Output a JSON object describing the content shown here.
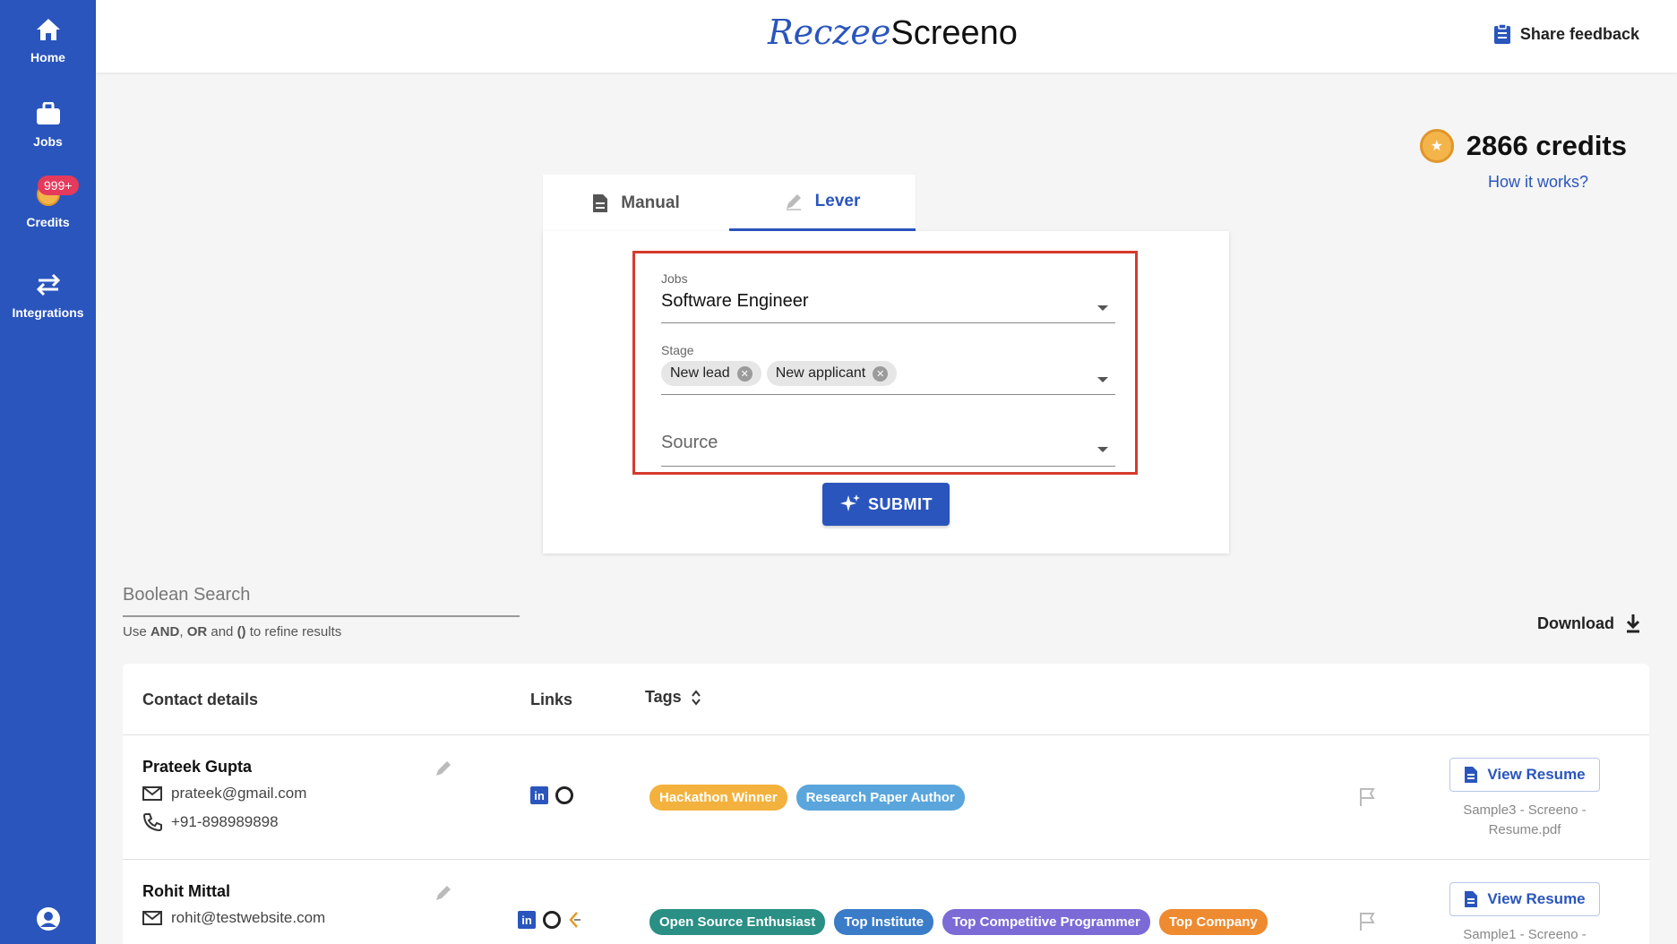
{
  "sidebar": {
    "items": [
      {
        "label": "Home",
        "icon": "home-icon"
      },
      {
        "label": "Jobs",
        "icon": "briefcase-icon"
      },
      {
        "label": "Credits",
        "icon": "coin-icon",
        "badge": "999+"
      },
      {
        "label": "Integrations",
        "icon": "swap-arrows-icon"
      }
    ]
  },
  "header": {
    "logo_part1": "Reczee",
    "logo_part2": "Screeno",
    "share_feedback": "Share feedback"
  },
  "credits": {
    "amount": "2866 credits",
    "how_it_works": "How it works?"
  },
  "tabs": [
    {
      "label": "Manual",
      "icon": "document-icon"
    },
    {
      "label": "Lever",
      "icon": "pencil-icon",
      "active": true
    }
  ],
  "form": {
    "jobs_label": "Jobs",
    "jobs_value": "Software Engineer",
    "stage_label": "Stage",
    "stage_chips": [
      "New lead",
      "New applicant"
    ],
    "source_placeholder": "Source",
    "submit_label": "SUBMIT"
  },
  "search": {
    "placeholder": "Boolean Search",
    "hint_parts": [
      "Use ",
      "AND",
      ", ",
      "OR",
      " and ",
      "()",
      " to refine results"
    ],
    "download_label": "Download"
  },
  "table": {
    "headers": {
      "contact": "Contact details",
      "links": "Links",
      "tags": "Tags"
    },
    "rows": [
      {
        "name": "Prateek Gupta",
        "email": "prateek@gmail.com",
        "phone": "+91-898989898",
        "tags": [
          {
            "label": "Hackathon Winner",
            "color": "#f3b23d"
          },
          {
            "label": "Research Paper Author",
            "color": "#5aa6dc"
          }
        ],
        "view_resume": "View Resume",
        "file_line1": "Sample3 - Screeno -",
        "file_line2": "Resume.pdf"
      },
      {
        "name": "Rohit Mittal",
        "email": "rohit@testwebsite.com",
        "tags": [
          {
            "label": "Open Source Enthusiast",
            "color": "#2a8f85"
          },
          {
            "label": "Top Institute",
            "color": "#3a7cc8"
          },
          {
            "label": "Top Competitive Programmer",
            "color": "#7c6bd6"
          },
          {
            "label": "Top Company",
            "color": "#ee8a30"
          }
        ],
        "view_resume": "View Resume",
        "file_line1": "Sample1 - Screeno -"
      }
    ]
  },
  "colors": {
    "primary": "#2a55bd",
    "highlight_border": "#d63a2c",
    "badge": "#e53a5c",
    "coin": "#f3b54a"
  }
}
